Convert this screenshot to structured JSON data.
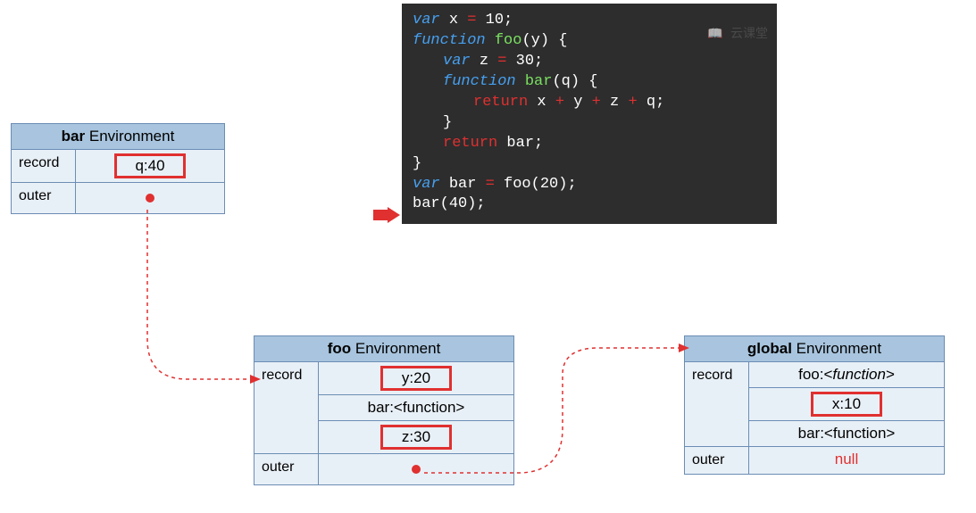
{
  "envs": {
    "bar": {
      "name": "bar",
      "title_suffix": "Environment",
      "record_label": "record",
      "outer_label": "outer",
      "records": [
        {
          "text": "q:40",
          "highlight": true
        }
      ]
    },
    "foo": {
      "name": "foo",
      "title_suffix": "Environment",
      "record_label": "record",
      "outer_label": "outer",
      "records": [
        {
          "text": "y:20",
          "highlight": true
        },
        {
          "text": "bar:<function>",
          "highlight": false
        },
        {
          "text": "z:30",
          "highlight": true
        }
      ]
    },
    "global": {
      "name": "global",
      "title_suffix": "Environment",
      "record_label": "record",
      "outer_label": "outer",
      "records": [
        {
          "text": "foo:<function>",
          "highlight": false,
          "italic_part": "function"
        },
        {
          "text": "x:10",
          "highlight": true
        },
        {
          "text": "bar:<function>",
          "highlight": false
        }
      ],
      "outer_value": "null"
    }
  },
  "code": {
    "lines": [
      {
        "parts": [
          {
            "t": "var ",
            "c": "kw"
          },
          {
            "t": "x ",
            "c": "id"
          },
          {
            "t": "= ",
            "c": "op"
          },
          {
            "t": "10",
            "c": "num"
          },
          {
            "t": ";",
            "c": "punc"
          }
        ]
      },
      {
        "parts": [
          {
            "t": "function ",
            "c": "kw"
          },
          {
            "t": "foo",
            "c": "fn"
          },
          {
            "t": "(",
            "c": "punc"
          },
          {
            "t": "y",
            "c": "id"
          },
          {
            "t": ") {",
            "c": "punc"
          }
        ]
      },
      {
        "indent": 1,
        "parts": [
          {
            "t": "var ",
            "c": "kw"
          },
          {
            "t": "z ",
            "c": "id"
          },
          {
            "t": "= ",
            "c": "op"
          },
          {
            "t": "30",
            "c": "num"
          },
          {
            "t": ";",
            "c": "punc"
          }
        ]
      },
      {
        "indent": 1,
        "parts": [
          {
            "t": "function ",
            "c": "kw"
          },
          {
            "t": "bar",
            "c": "fn"
          },
          {
            "t": "(",
            "c": "punc"
          },
          {
            "t": "q",
            "c": "id"
          },
          {
            "t": ") {",
            "c": "punc"
          }
        ]
      },
      {
        "indent": 2,
        "parts": [
          {
            "t": "return ",
            "c": "ret"
          },
          {
            "t": "x ",
            "c": "id"
          },
          {
            "t": "+ ",
            "c": "op"
          },
          {
            "t": "y ",
            "c": "id"
          },
          {
            "t": "+ ",
            "c": "op"
          },
          {
            "t": "z ",
            "c": "id"
          },
          {
            "t": "+ ",
            "c": "op"
          },
          {
            "t": "q",
            "c": "id"
          },
          {
            "t": ";",
            "c": "punc"
          }
        ]
      },
      {
        "indent": 1,
        "parts": [
          {
            "t": "}",
            "c": "punc"
          }
        ]
      },
      {
        "indent": 1,
        "parts": [
          {
            "t": "return ",
            "c": "ret"
          },
          {
            "t": "bar",
            "c": "id"
          },
          {
            "t": ";",
            "c": "punc"
          }
        ]
      },
      {
        "parts": [
          {
            "t": "}",
            "c": "punc"
          }
        ]
      },
      {
        "parts": [
          {
            "t": "var ",
            "c": "kw"
          },
          {
            "t": "bar ",
            "c": "id"
          },
          {
            "t": "= ",
            "c": "op"
          },
          {
            "t": "foo",
            "c": "id"
          },
          {
            "t": "(",
            "c": "punc"
          },
          {
            "t": "20",
            "c": "num"
          },
          {
            "t": ")",
            "c": "punc"
          },
          {
            "t": ";",
            "c": "punc"
          }
        ]
      },
      {
        "parts": [
          {
            "t": "bar",
            "c": "id"
          },
          {
            "t": "(",
            "c": "punc"
          },
          {
            "t": "40",
            "c": "num"
          },
          {
            "t": ")",
            "c": "punc"
          },
          {
            "t": ";",
            "c": "punc"
          }
        ]
      }
    ]
  },
  "watermark": "云课堂"
}
